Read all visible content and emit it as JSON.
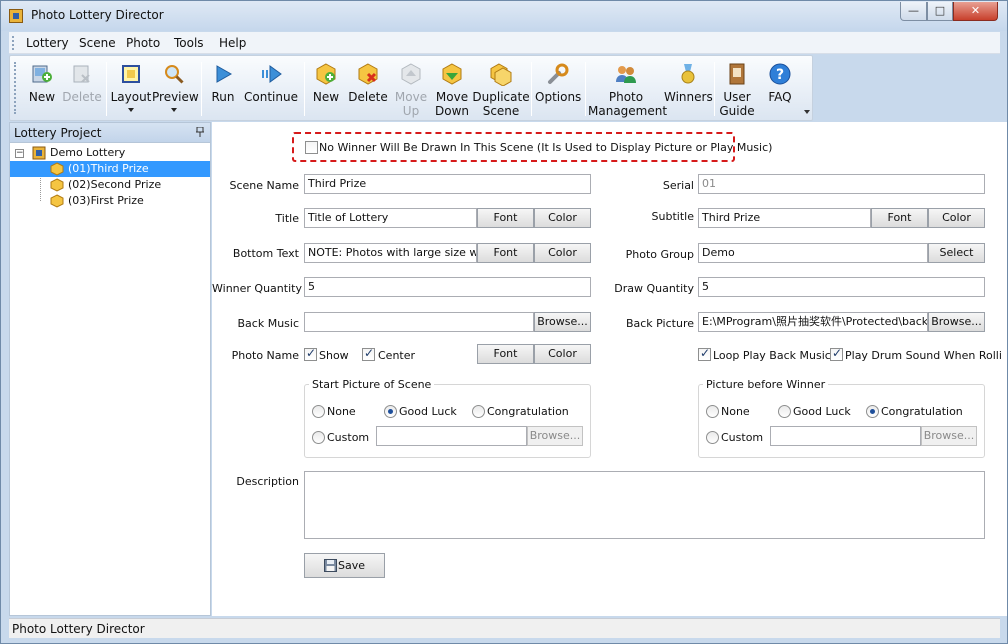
{
  "window": {
    "title": "Photo Lottery Director",
    "minimize_glyph": "—",
    "maximize_glyph": "□",
    "close_glyph": "✕"
  },
  "menu": [
    "Lottery",
    "Scene",
    "Photo",
    "Tools",
    "Help"
  ],
  "toolbar": {
    "new_lottery": "New",
    "delete_lottery": "Delete",
    "layout": "Layout",
    "preview": "Preview",
    "run": "Run",
    "continue": "Continue",
    "new_scene": "New",
    "delete_scene": "Delete",
    "move_up": [
      "Move",
      "Up"
    ],
    "move_down": [
      "Move",
      "Down"
    ],
    "duplicate_scene": [
      "Duplicate",
      "Scene"
    ],
    "options": "Options",
    "photo_management": [
      "Photo",
      "Management"
    ],
    "winners": "Winners",
    "user_guide": [
      "User",
      "Guide"
    ],
    "faq": "FAQ"
  },
  "left_panel": {
    "title": "Lottery Project",
    "expander": "−",
    "root": "Demo Lottery",
    "items": [
      "(01)Third Prize",
      "(02)Second Prize",
      "(03)First Prize"
    ],
    "selected_index": 0
  },
  "form": {
    "no_winner_label": "No Winner Will Be Drawn In This Scene  (It Is Used to Display Picture or Play Music)",
    "no_winner_checked": false,
    "scene_name_label": "Scene Name",
    "scene_name": "Third Prize",
    "serial_label": "Serial",
    "serial": "01",
    "title_label": "Title",
    "title": "Title of Lottery",
    "subtitle_label": "Subtitle",
    "subtitle": "Third Prize",
    "bottom_text_label": "Bottom Text",
    "bottom_text": "NOTE: Photos with large size will make",
    "photo_group_label": "Photo Group",
    "photo_group": "Demo",
    "winner_quantity_label": "Winner Quantity",
    "winner_quantity": "5",
    "draw_quantity_label": "Draw Quantity",
    "draw_quantity": "5",
    "back_music_label": "Back Music",
    "back_music": "",
    "back_picture_label": "Back Picture",
    "back_picture": "E:\\MProgram\\照片抽奖软件\\Protected\\back.jpg",
    "photo_name_label": "Photo Name",
    "show_label": "Show",
    "center_label": "Center",
    "loop_music_label": "Loop Play Back Music",
    "drum_sound_label": "Play Drum Sound When Rolling Photos",
    "font_btn": "Font",
    "color_btn": "Color",
    "browse_btn": "Browse...",
    "select_btn": "Select",
    "start_picture_title": "Start Picture of Scene",
    "before_winner_title": "Picture before Winner",
    "opt_none": "None",
    "opt_good_luck": "Good Luck",
    "opt_congratulation": "Congratulation",
    "opt_custom": "Custom",
    "start_selected": "Good Luck",
    "before_selected": "Congratulation",
    "description_label": "Description",
    "description": "",
    "save_btn": "Save"
  },
  "status": "Photo Lottery Director"
}
